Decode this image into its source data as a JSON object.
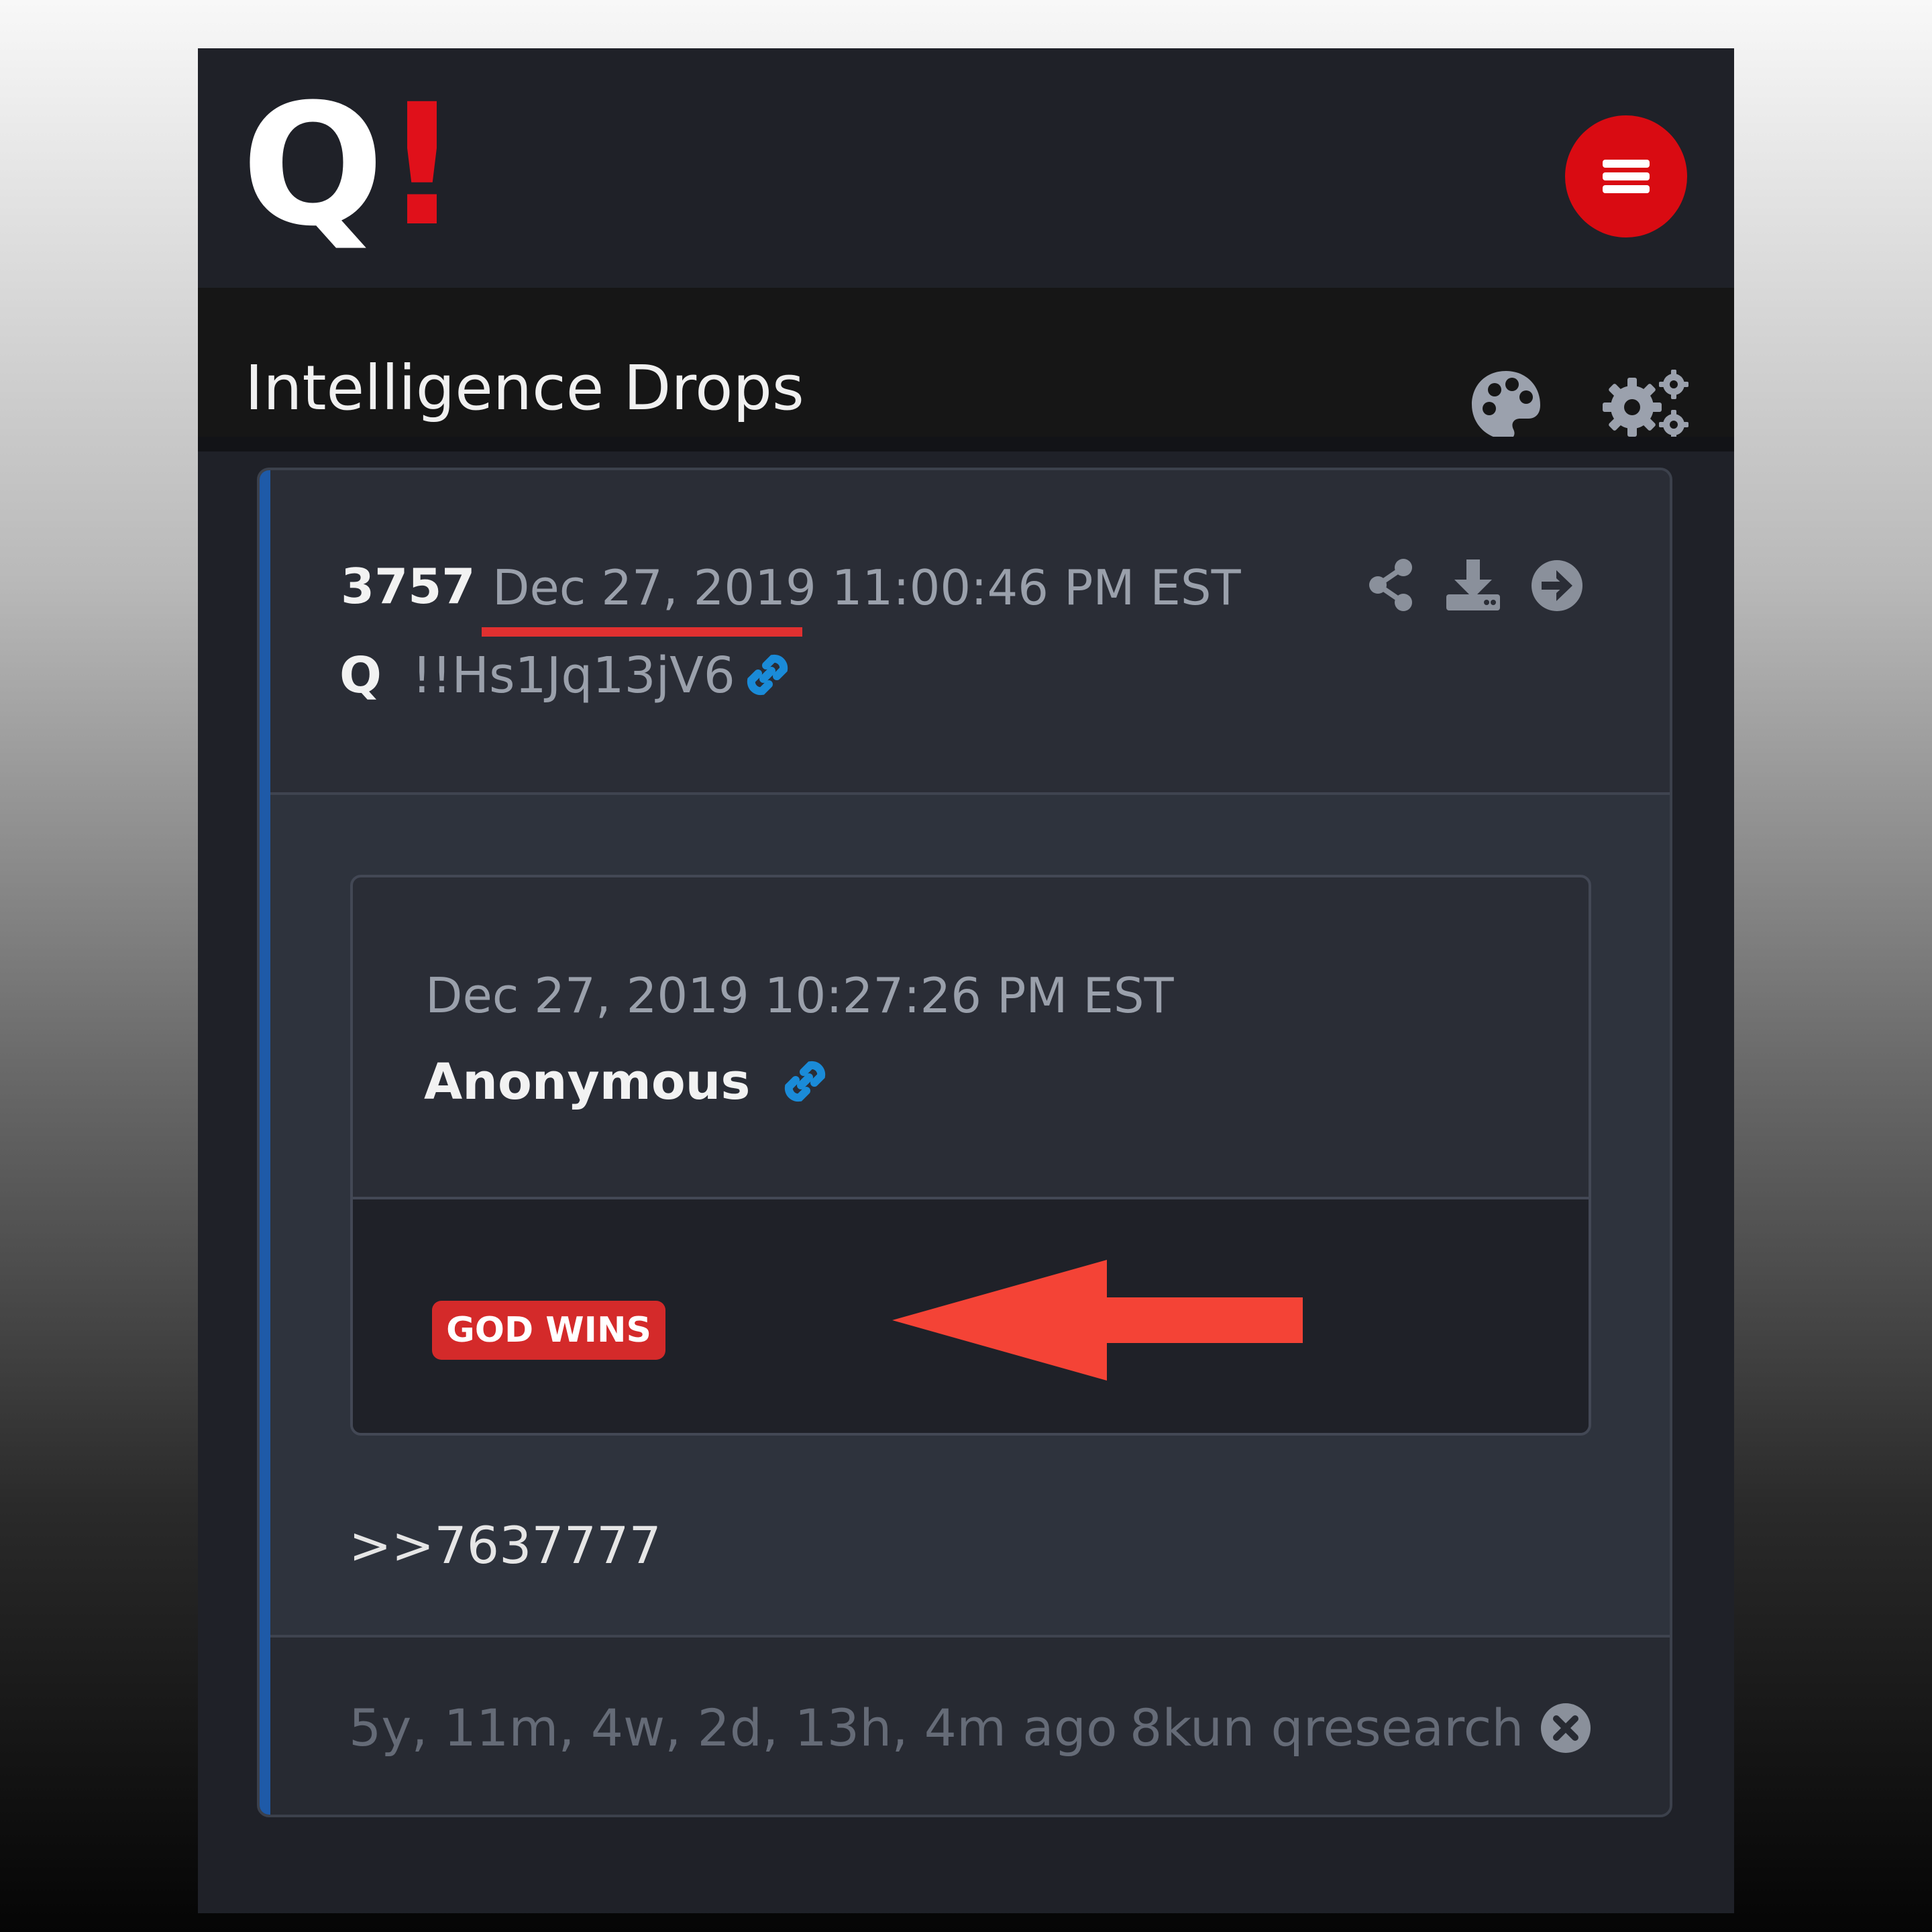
{
  "header": {
    "logo_letter": "Q",
    "logo_mark": "!",
    "menu_icon": "hamburger-menu-icon",
    "brand_red": "#d90b12"
  },
  "subheader": {
    "title": "Intelligence Drops",
    "icons": [
      "palette-icon",
      "gears-icon"
    ]
  },
  "drop": {
    "number": "3757",
    "date": "Dec 27, 2019 11:00:46 PM EST",
    "author": "Q",
    "tripcode": "!!Hs1Jq13jV6",
    "action_icons": [
      "share-icon",
      "download-icon",
      "arrow-right-circle-icon",
      "link-icon"
    ],
    "accent_color": "#1e5aa8",
    "quoted": {
      "date": "Dec 27, 2019 10:27:26 PM EST",
      "author": "Anonymous",
      "image_label": "GOD WINS"
    },
    "reply": ">>7637777",
    "age": "5y, 11m, 4w, 2d, 13h, 4m ago",
    "source": "8kun qresearch"
  },
  "annotation": {
    "color": "#f44336"
  }
}
